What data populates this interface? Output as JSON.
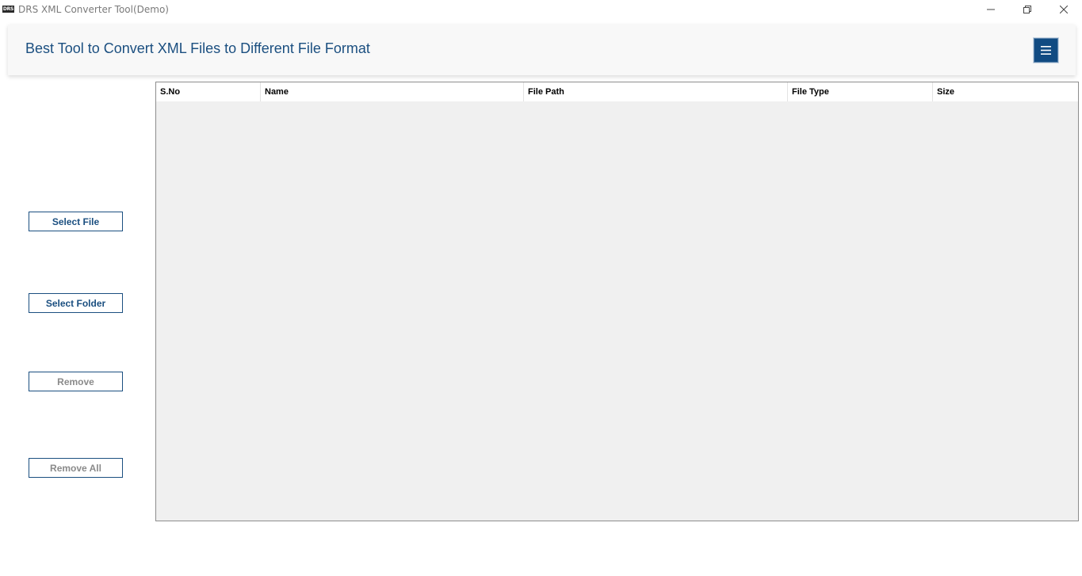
{
  "window": {
    "app_icon_text": "DRS",
    "title": "DRS XML Converter Tool(Demo)",
    "icons": {
      "minimize": "minimize-icon",
      "maximize": "restore-icon",
      "close": "close-icon",
      "menu": "hamburger-menu-icon"
    }
  },
  "header": {
    "title": "Best Tool to Convert XML Files to Different File Format",
    "title_color": "#1b4f80",
    "menu_button_color": "#114b82"
  },
  "sidebar": {
    "select_file": "Select File",
    "select_folder": "Select Folder",
    "remove": "Remove",
    "remove_all": "Remove All"
  },
  "table": {
    "columns": [
      "S.No",
      "Name",
      "File Path",
      "File Type",
      "Size"
    ],
    "rows": []
  }
}
